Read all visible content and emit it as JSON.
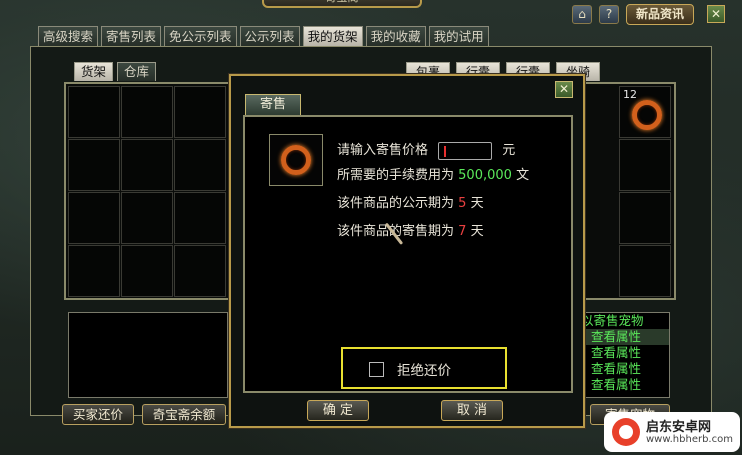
{
  "window": {
    "title": "奇宝阁"
  },
  "topbar": {
    "home_icon": "home-icon",
    "help_label": "?",
    "news_button": "新品资讯",
    "close_label": "✕"
  },
  "tabs": [
    {
      "label": "高级搜索",
      "active": false
    },
    {
      "label": "寄售列表",
      "active": false
    },
    {
      "label": "免公示列表",
      "active": false
    },
    {
      "label": "公示列表",
      "active": false
    },
    {
      "label": "我的货架",
      "active": true
    },
    {
      "label": "我的收藏",
      "active": false
    },
    {
      "label": "我的试用",
      "active": false
    }
  ],
  "subtabs": [
    {
      "label": "货架",
      "active": true
    },
    {
      "label": "仓库",
      "active": false
    }
  ],
  "right_subtabs": [
    "包裹",
    "行囊",
    "行囊",
    "坐骑"
  ],
  "inventory": {
    "slot_count": "12"
  },
  "right_list": {
    "items": [
      "以寄售宠物",
      "查看属性",
      "查看属性",
      "查看属性",
      "查看属性"
    ]
  },
  "bottom_buttons": {
    "buyer_counter": "买家还价",
    "balance": "奇宝斋余额",
    "consign": "寄售宠物"
  },
  "modal": {
    "tab_label": "寄售",
    "close_label": "✕",
    "price_prompt": "请输入寄售价格",
    "price_value": "",
    "price_unit": "元",
    "fee_prefix": "所需要的手续费用为",
    "fee_value": "500,000",
    "fee_unit": "文",
    "publicity_prefix": "该件商品的公示期为",
    "publicity_days": "5",
    "publicity_unit": "天",
    "consign_prefix": "该件商品的寄售期为",
    "consign_days": "7",
    "consign_unit": "天",
    "reject_counter_label": "拒绝还价",
    "reject_counter_checked": false,
    "confirm_button": "确  定",
    "cancel_button": "取  消"
  },
  "watermark": {
    "text": "启东安卓网",
    "url": "www.hbherb.com"
  },
  "colors": {
    "accent_gold": "#b89a4a",
    "green_text": "#5ae85a",
    "red_text": "#e84040"
  }
}
